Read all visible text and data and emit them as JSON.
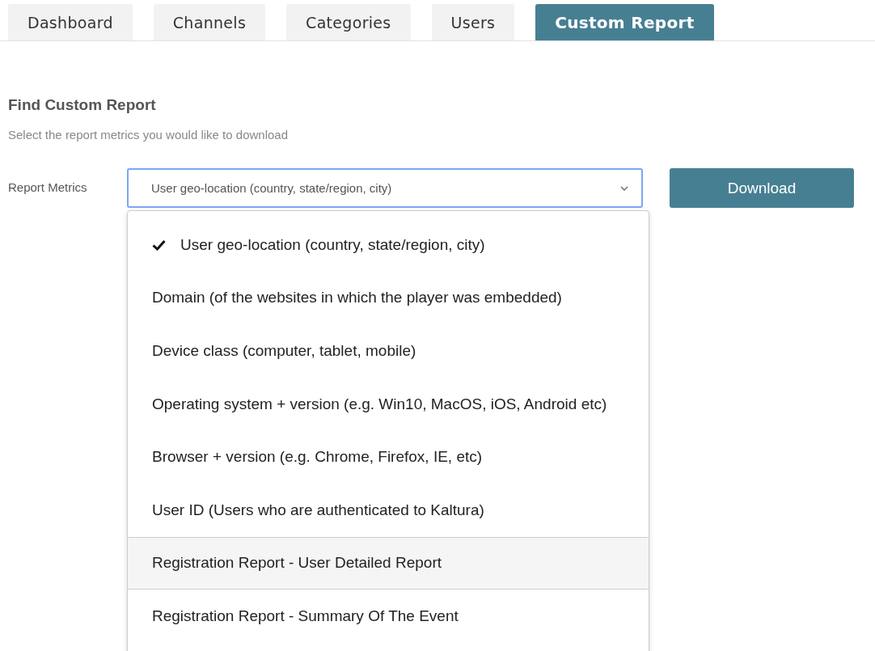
{
  "tabs": [
    {
      "label": "Dashboard",
      "selected": false
    },
    {
      "label": "Channels",
      "selected": false
    },
    {
      "label": "Categories",
      "selected": false
    },
    {
      "label": "Users",
      "selected": false
    },
    {
      "label": "Custom Report",
      "selected": true
    }
  ],
  "section": {
    "title": "Find Custom Report",
    "subtitle": "Select the report metrics you would like to download"
  },
  "report_metrics": {
    "label": "Report Metrics",
    "value": "User geo-location (country, state/region, city)",
    "expanded": true,
    "options": [
      {
        "label": "User geo-location (country, state/region, city)",
        "selected": true,
        "highlighted": false
      },
      {
        "label": "Domain (of the websites in which the player was embedded)",
        "selected": false,
        "highlighted": false
      },
      {
        "label": "Device class (computer, tablet, mobile)",
        "selected": false,
        "highlighted": false
      },
      {
        "label": "Operating system + version (e.g. Win10, MacOS, iOS, Android etc)",
        "selected": false,
        "highlighted": false
      },
      {
        "label": "Browser + version (e.g. Chrome, Firefox, IE, etc)",
        "selected": false,
        "highlighted": false
      },
      {
        "label": "User ID (Users who are authenticated to Kaltura)",
        "selected": false,
        "highlighted": false
      },
      {
        "label": "Registration Report - User Detailed Report",
        "selected": false,
        "highlighted": true
      },
      {
        "label": "Registration Report - Summary Of The Event",
        "selected": false,
        "highlighted": false
      }
    ]
  },
  "download_button": "Download"
}
